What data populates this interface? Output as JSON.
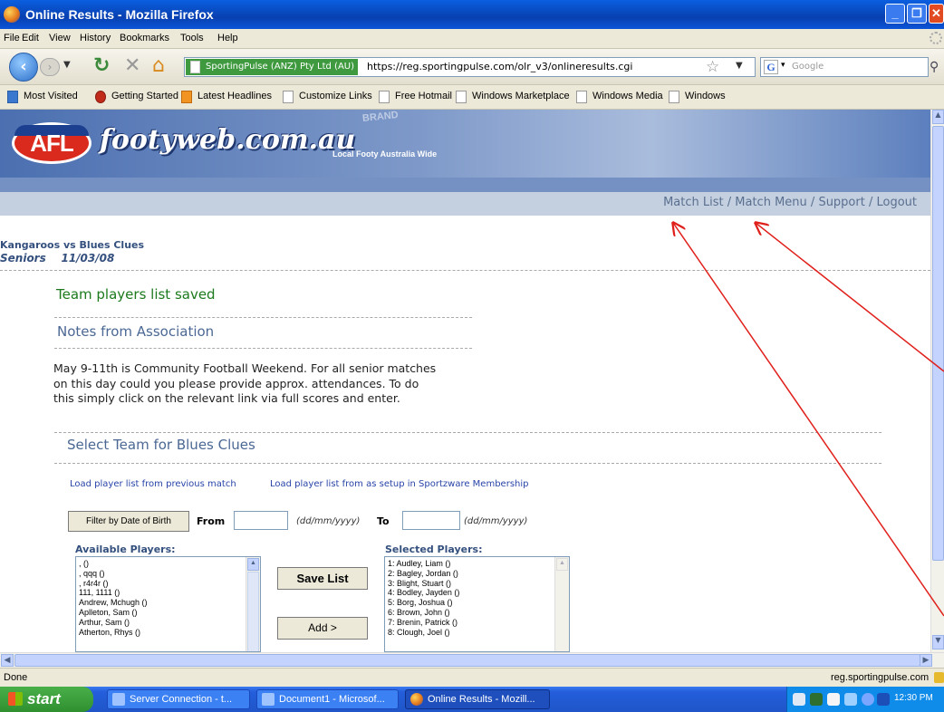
{
  "window": {
    "title": "Online Results - Mozilla Firefox"
  },
  "menu": [
    "File",
    "Edit",
    "View",
    "History",
    "Bookmarks",
    "Tools",
    "Help"
  ],
  "nav": {
    "site_identity": "SportingPulse (ANZ) Pty Ltd (AU)",
    "url": "https://reg.sportingpulse.com/olr_v3/onlineresults.cgi",
    "search_placeholder": "Google",
    "search_engine": "G"
  },
  "bookmarks": [
    "Most Visited",
    "Getting Started",
    "Latest Headlines",
    "Customize Links",
    "Free Hotmail",
    "Windows Marketplace",
    "Windows Media",
    "Windows"
  ],
  "site": {
    "logo_text": "AFL",
    "name": "footyweb.com.au",
    "tagline": "Local Footy Australia Wide",
    "brand_banner": "BRAND"
  },
  "navlinks": {
    "match_list": "Match List",
    "match_menu": "Match Menu",
    "support": "Support",
    "logout": "Logout",
    "sep": " / "
  },
  "match": {
    "teams": "Kangaroos vs Blues Clues",
    "grade": "Seniors",
    "date": "11/03/08"
  },
  "saved_message": "Team players list saved",
  "notes": {
    "heading": "Notes from Association",
    "body": "May 9-11th is Community Football Weekend. For all senior matches on this day could you please provide approx. attendances. To do this simply click on the relevant link via full scores and enter."
  },
  "team_select": {
    "heading": "Select Team for Blues Clues",
    "load_previous": "Load player list from previous match",
    "load_sportzware": "Load player list from as setup in Sportzware Membership",
    "filter_button": "Filter by Date of Birth",
    "from_label": "From",
    "to_label": "To",
    "date_hint": "(dd/mm/yyyy)",
    "available_label": "Available Players:",
    "selected_label": "Selected Players:",
    "save_button": "Save List",
    "add_button": "Add >",
    "available_players": [
      ", ()",
      ", qqq ()",
      ", r4r4r ()",
      "111, 1111 ()",
      "Andrew, Mchugh ()",
      "Aplleton, Sam ()",
      "Arthur, Sam ()",
      "Atherton, Rhys ()"
    ],
    "selected_players": [
      "1: Audley, Liam ()",
      "2: Bagley, Jordan ()",
      "3: Blight, Stuart ()",
      "4: Bodley, Jayden ()",
      "5: Borg, Joshua ()",
      "6: Brown, John ()",
      "7: Brenin, Patrick ()",
      "8: Clough, Joel ()"
    ]
  },
  "status": {
    "text": "Done",
    "host": "reg.sportingpulse.com"
  },
  "taskbar": {
    "start": "start",
    "tasks": [
      "Server Connection - t...",
      "Document1 - Microsof...",
      "Online Results - Mozill..."
    ],
    "clock": "12:30 PM"
  },
  "colors": {
    "annotation": "#e0201b",
    "saved": "#1c7a1c",
    "heading": "#4b6894",
    "link": "#2844a8"
  }
}
